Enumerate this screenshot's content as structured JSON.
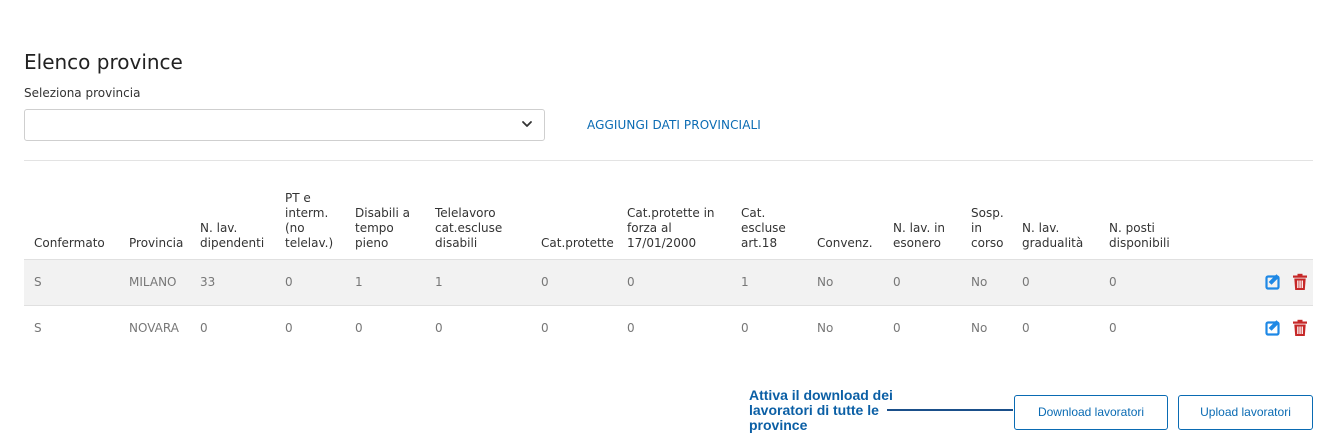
{
  "page": {
    "title": "Elenco province",
    "select_label": "Seleziona provincia",
    "select_value": "",
    "add_link": "AGGIUNGI DATI PROVINCIALI"
  },
  "table": {
    "columns": [
      "Confermato",
      "Provincia",
      "N. lav. dipendenti",
      "PT e interm. (no telelav.)",
      "Disabili a tempo pieno",
      "Telelavoro cat.escluse disabili",
      "Cat.protette",
      "Cat.protette in forza al 17/01/2000",
      "Cat. escluse art.18",
      "Convenz.",
      "N. lav. in esonero",
      "Sosp. in corso",
      "N. lav. gradualità",
      "N. posti disponibili"
    ],
    "rows": [
      [
        "S",
        "MILANO",
        "33",
        "0",
        "1",
        "1",
        "0",
        "0",
        "1",
        "No",
        "0",
        "No",
        "0",
        "0"
      ],
      [
        "S",
        "NOVARA",
        "0",
        "0",
        "0",
        "0",
        "0",
        "0",
        "0",
        "No",
        "0",
        "No",
        "0",
        "0"
      ]
    ]
  },
  "icons": {
    "edit": "edit-icon",
    "delete": "trash-icon",
    "edit_color": "#1e88e5",
    "delete_color": "#c62828"
  },
  "annotation": {
    "text": "Attiva il download dei lavoratori di tutte le province"
  },
  "buttons": {
    "download": "Download lavoratori",
    "upload": "Upload lavoratori"
  }
}
